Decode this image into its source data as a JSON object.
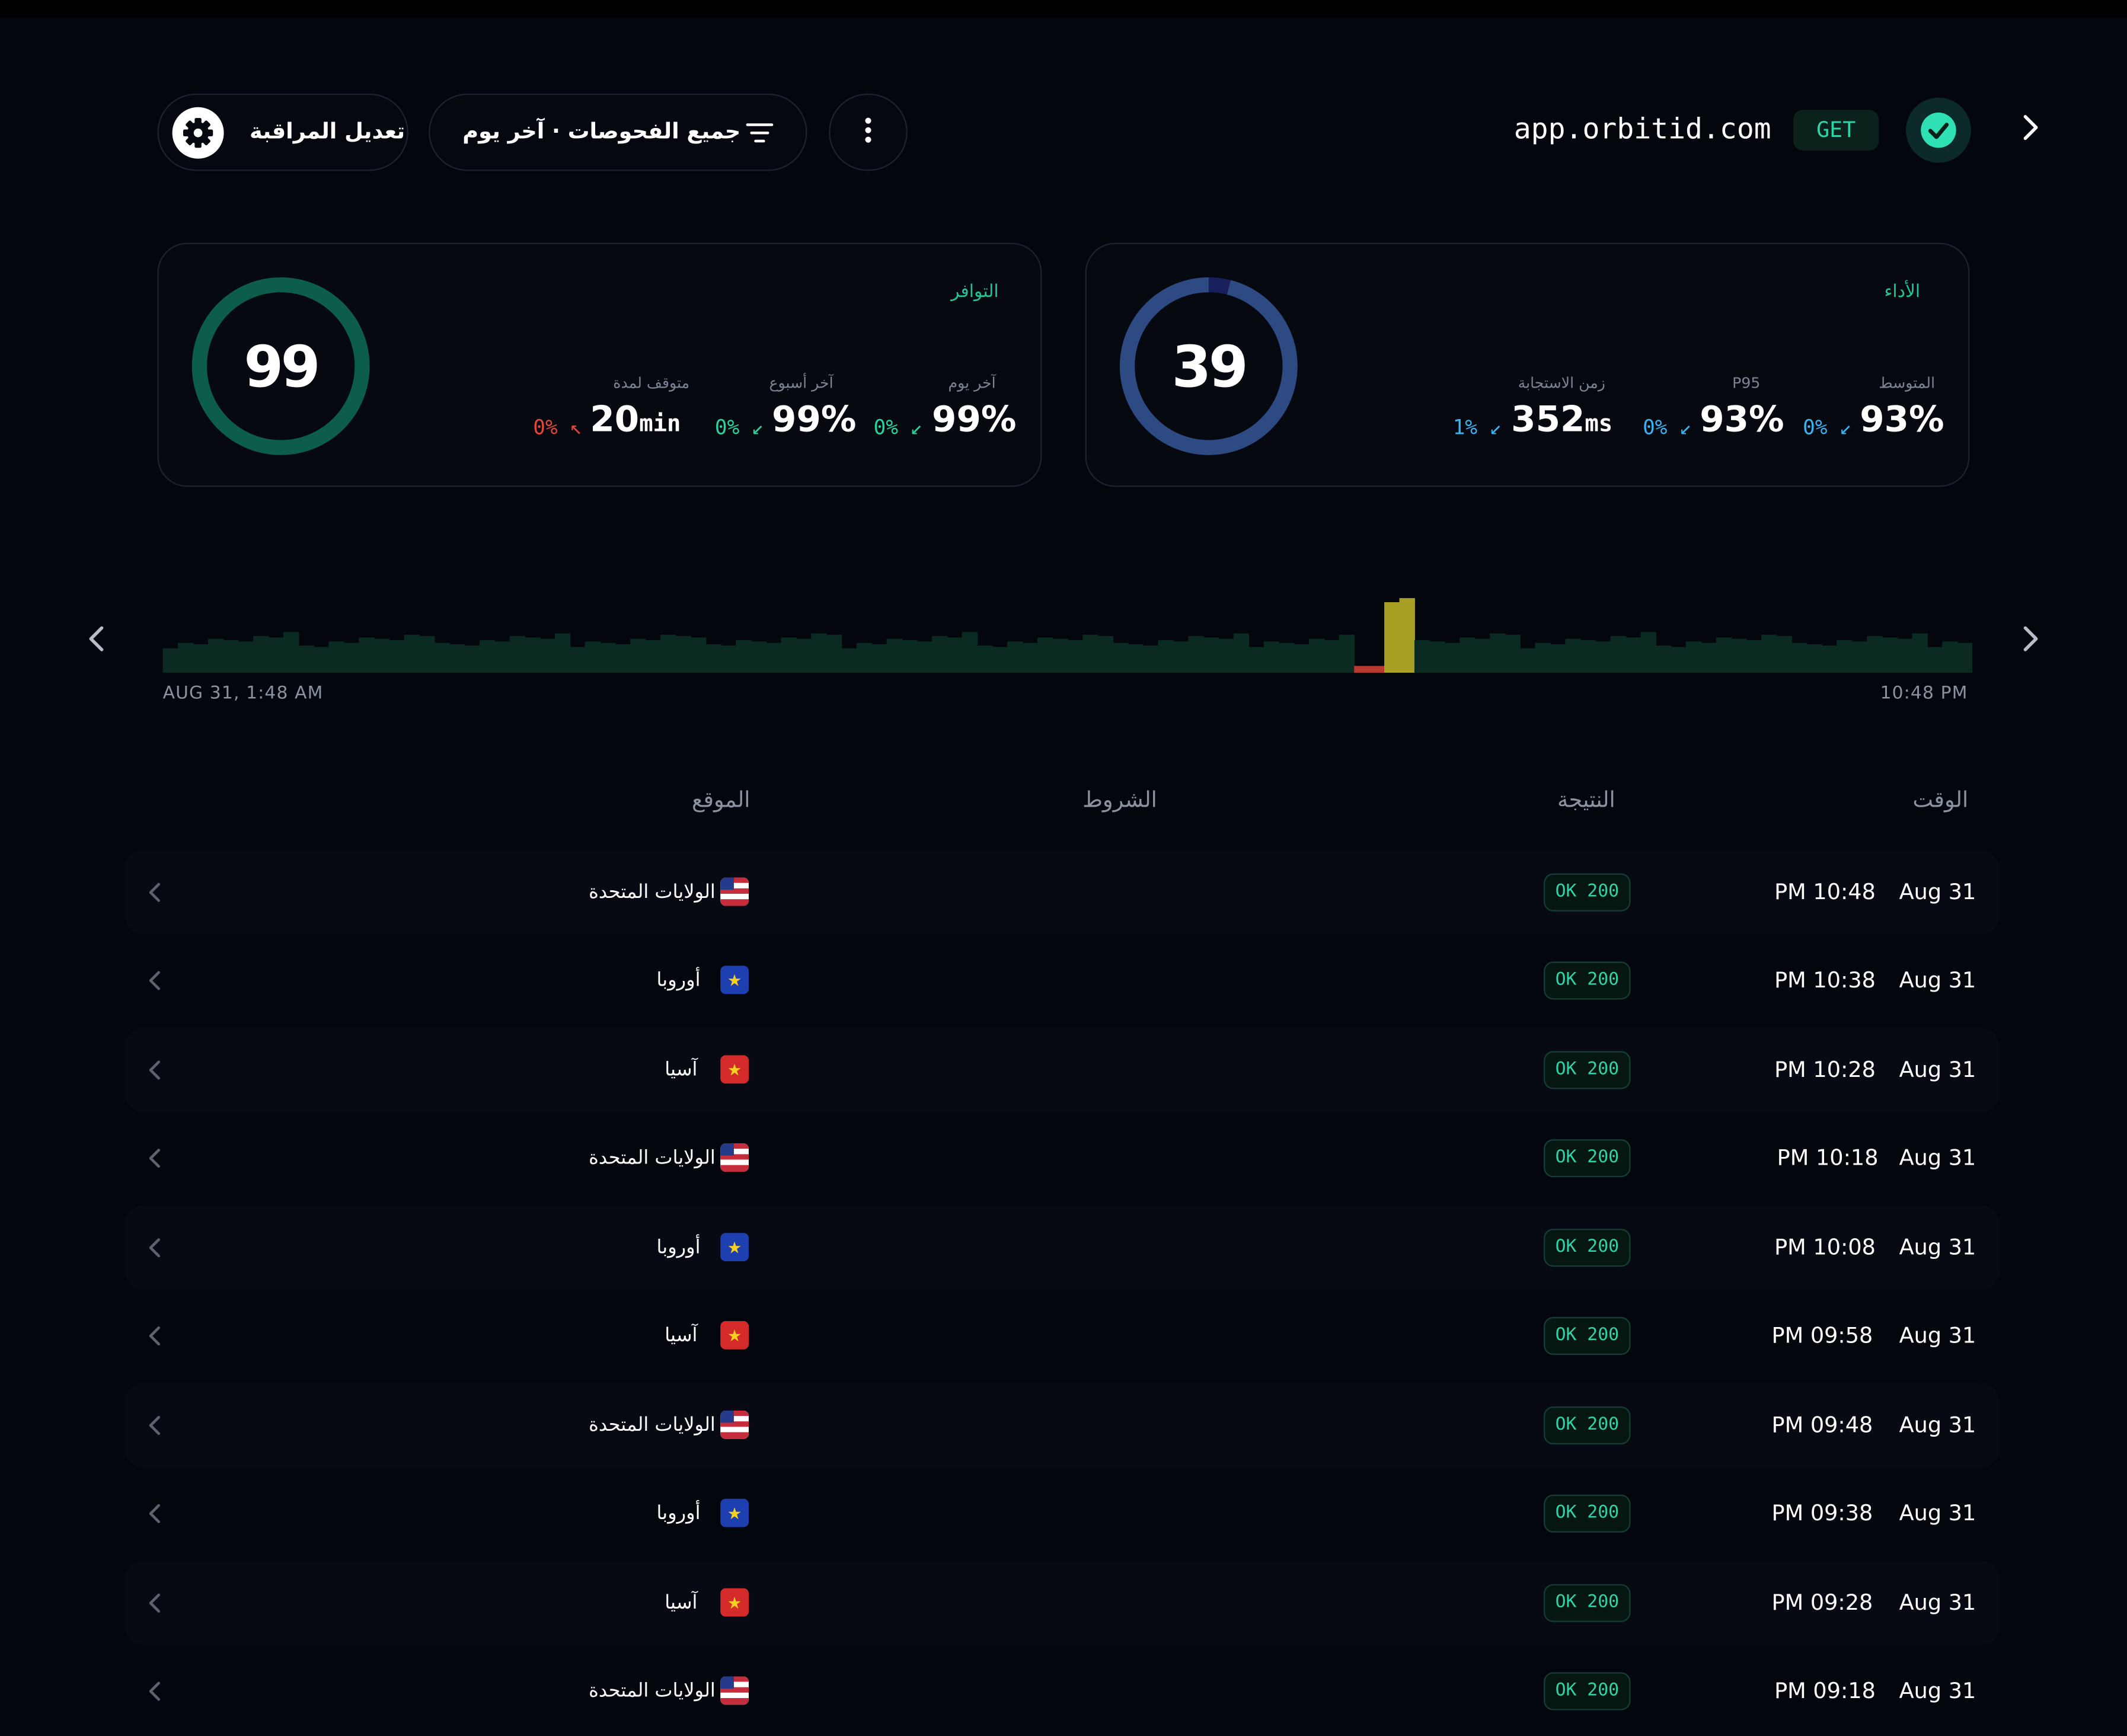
{
  "header": {
    "url": "app.orbitid.com",
    "method": "GET",
    "status_icon": "check-icon",
    "menu_icon": "more-vertical-icon",
    "filter_label": "جميع الفحوصات · آخر يوم",
    "filter_icon": "filter-icon",
    "edit_label": "تعديل المراقبة",
    "edit_icon": "gear-icon",
    "expand_icon": "chevron-right-icon"
  },
  "availability": {
    "title": "التوافر",
    "score": "99",
    "score_fraction": 0.99,
    "ring_color": "#0c5e4a",
    "metrics": [
      {
        "label": "آخر يوم",
        "value": "99%",
        "delta": "0%",
        "trend": "down",
        "color": "#28d3a3"
      },
      {
        "label": "آخر أسبوع",
        "value": "99%",
        "delta": "0%",
        "trend": "down",
        "color": "#28d3a3"
      },
      {
        "label": "متوقف لمدة",
        "value": "20",
        "unit": "min",
        "delta": "0%",
        "trend": "up",
        "color": "#e2473a"
      }
    ]
  },
  "performance": {
    "title": "الأداء",
    "score": "39",
    "score_fraction": 0.96,
    "ring_color": "#2e4a82",
    "metrics": [
      {
        "label": "المتوسط",
        "value": "93%",
        "delta": "0%",
        "trend": "down",
        "color": "#3bb3f0"
      },
      {
        "label": "P95",
        "value": "93%",
        "delta": "0%",
        "trend": "down",
        "color": "#3bb3f0"
      },
      {
        "label": "زمن الاستجابة",
        "value": "352",
        "unit": "ms",
        "delta": "1%",
        "trend": "down",
        "color": "#3bb3f0"
      }
    ]
  },
  "timeline": {
    "start_label": "AUG 31, 1:48 AM",
    "end_label": "10:48 PM",
    "prev_icon": "chevron-left-icon",
    "next_icon": "chevron-right-icon",
    "colors": {
      "ok": "#0b2a22",
      "down": "#b8392e",
      "degraded": "#a8a024"
    }
  },
  "table": {
    "headers": {
      "time": "الوقت",
      "result": "النتيجة",
      "conditions": "الشروط",
      "location": "الموقع"
    },
    "rows": [
      {
        "date": "Aug 31",
        "time": "PM 10:48",
        "result": "OK 200",
        "location": "الولايات المتحدة",
        "flag": "us-flag-icon"
      },
      {
        "date": "Aug 31",
        "time": "PM 10:38",
        "result": "OK 200",
        "location": "أوروبا",
        "flag": "eu-flag-icon"
      },
      {
        "date": "Aug 31",
        "time": "PM 10:28",
        "result": "OK 200",
        "location": "آسيا",
        "flag": "vn-flag-icon"
      },
      {
        "date": "Aug 31",
        "time": "PM 10:18",
        "result": "OK 200",
        "location": "الولايات المتحدة",
        "flag": "us-flag-icon"
      },
      {
        "date": "Aug 31",
        "time": "PM 10:08",
        "result": "OK 200",
        "location": "أوروبا",
        "flag": "eu-flag-icon"
      },
      {
        "date": "Aug 31",
        "time": "PM 09:58",
        "result": "OK 200",
        "location": "آسيا",
        "flag": "vn-flag-icon"
      },
      {
        "date": "Aug 31",
        "time": "PM 09:48",
        "result": "OK 200",
        "location": "الولايات المتحدة",
        "flag": "us-flag-icon"
      },
      {
        "date": "Aug 31",
        "time": "PM 09:38",
        "result": "OK 200",
        "location": "أوروبا",
        "flag": "eu-flag-icon"
      },
      {
        "date": "Aug 31",
        "time": "PM 09:28",
        "result": "OK 200",
        "location": "آسيا",
        "flag": "vn-flag-icon"
      },
      {
        "date": "Aug 31",
        "time": "PM 09:18",
        "result": "OK 200",
        "location": "الولايات المتحدة",
        "flag": "us-flag-icon"
      }
    ]
  }
}
